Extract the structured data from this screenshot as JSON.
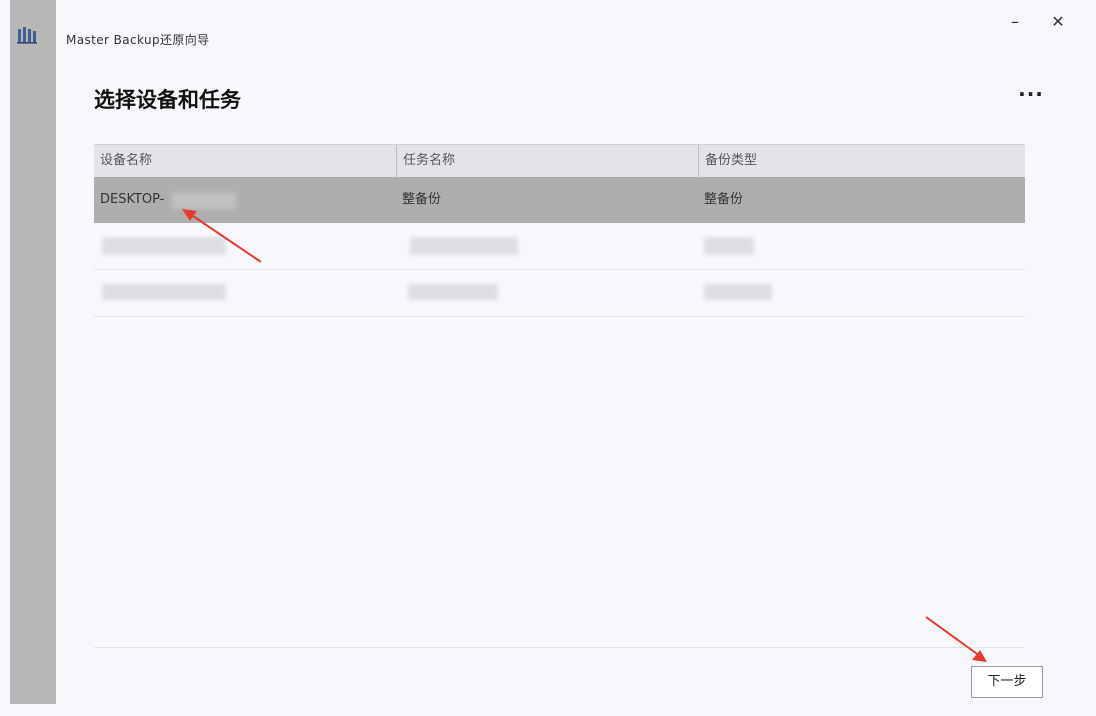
{
  "window": {
    "title": "Master Backup还原向导",
    "minimize_label": "–",
    "close_label": "✕"
  },
  "page": {
    "title": "选择设备和任务",
    "more_label": "···"
  },
  "table": {
    "columns": [
      "设备名称",
      "任务名称",
      "备份类型"
    ],
    "rows": [
      {
        "device": "DESKTOP-",
        "task": "整备份",
        "type": "整备份",
        "selected": true
      },
      {
        "device": "",
        "task": "",
        "type": "",
        "selected": false
      },
      {
        "device": "",
        "task": "",
        "type": "",
        "selected": false
      }
    ]
  },
  "footer": {
    "next_label": "下一步"
  },
  "colors": {
    "selected_row": "#aeaeae",
    "left_strip": "#b7b7b7",
    "annotation_arrow": "#e8392f"
  },
  "icons": {
    "app": "app-logo-icon",
    "more": "more-options-icon"
  }
}
